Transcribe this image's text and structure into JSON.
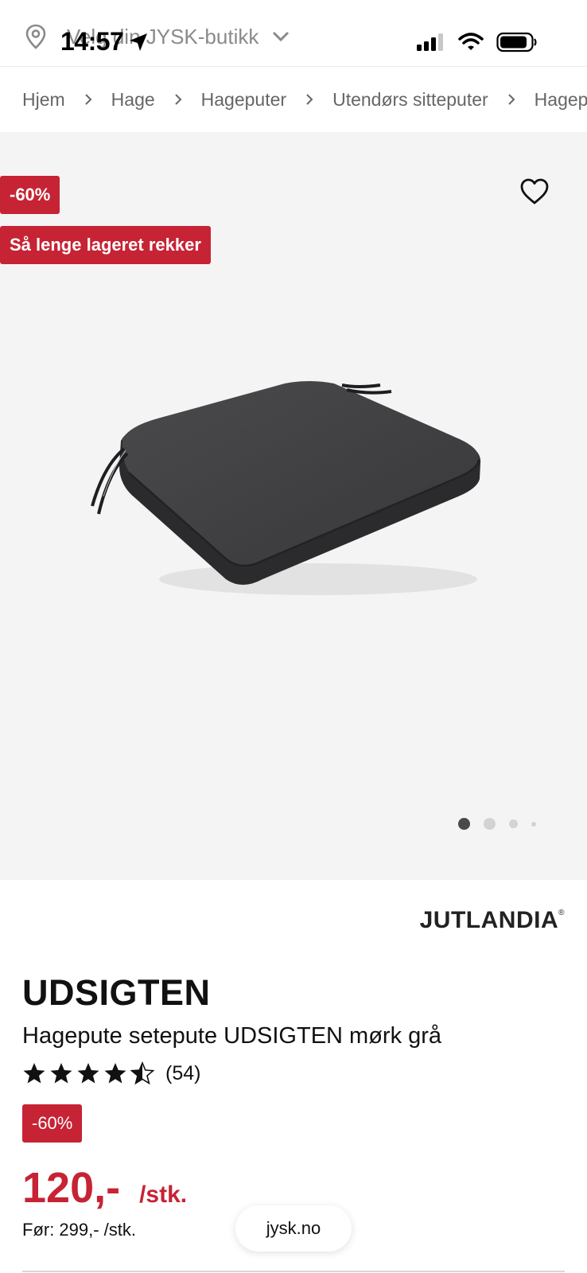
{
  "status_bar": {
    "time": "14:57"
  },
  "store_selector": {
    "label": "Velg din JYSK-butikk"
  },
  "breadcrumb": [
    "Hjem",
    "Hage",
    "Hageputer",
    "Utendørs sitteputer",
    "Hageput"
  ],
  "gallery": {
    "discount_badge": "-60%",
    "stock_badge": "Så lenge lageret rekker",
    "image_count": 4,
    "active_image": 1
  },
  "product": {
    "brand": "JUTLANDIA",
    "brand_mark": "®",
    "name": "UDSIGTEN",
    "description": "Hagepute setepute UDSIGTEN mørk grå",
    "rating": 4.5,
    "rating_max": 5,
    "review_count": "(54)",
    "discount_badge": "-60%",
    "price": "120,-",
    "unit": "/stk.",
    "before_price": "Før: 299,- /stk."
  },
  "browser": {
    "url": "jysk.no"
  },
  "colors": {
    "accent_red": "#c62334",
    "gallery_bg": "#f4f4f4"
  }
}
